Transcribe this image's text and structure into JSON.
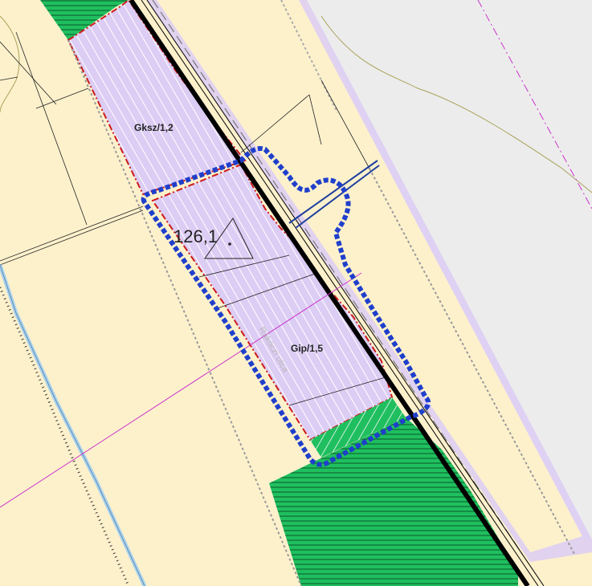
{
  "map": {
    "zones": [
      {
        "code": "Gksz/1,2",
        "type": "commercial-service zone"
      },
      {
        "code": "Gip/1,5",
        "type": "industrial zone"
      }
    ],
    "elevation_point": {
      "value": "126,1"
    },
    "road_label": "Rákóczi utca",
    "colors": {
      "background": "#fdf1cc",
      "right_area": "#ececec",
      "zone_fill": "#dccdf4",
      "zone_hatch": "#ffffff",
      "green_area": "#1fbf5f",
      "green_hatch": "#0b5a2a",
      "plan_boundary": "#1f3fcc",
      "zone_boundary": "#cc1a1a",
      "railway": "#000000",
      "creek": "#a7d3f0",
      "magenta_line": "#cc33cc",
      "road_border": "#cdbbee"
    }
  }
}
